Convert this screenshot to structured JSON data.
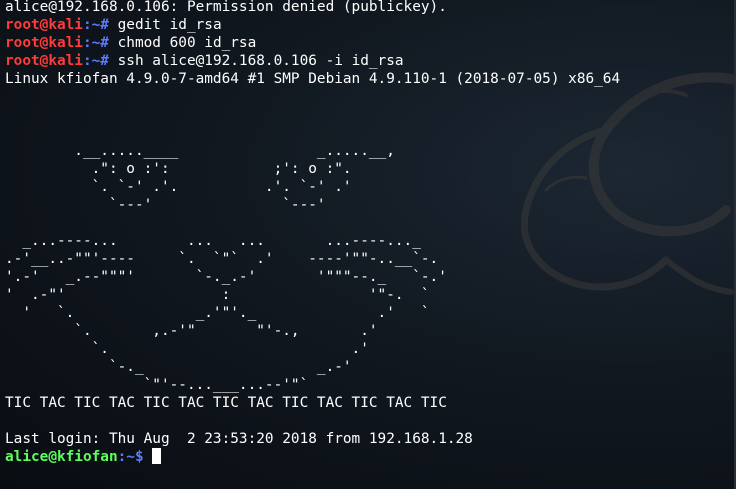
{
  "terminal": {
    "line_perm_denied": "alice@192.168.0.106: Permission denied (publickey).",
    "root_prompt_user": "root@kali",
    "root_prompt_path": ":~# ",
    "cmd1": "gedit id_rsa",
    "cmd2": "chmod 600 id_rsa",
    "cmd3": "ssh alice@192.168.0.106 -i id_rsa",
    "uname_line": "Linux kfiofan 4.9.0-7-amd64 #1 SMP Debian 4.9.110-1 (2018-07-05) x86_64",
    "banner_art": "\n\n\n        .__.....____                _.....__,\n          .\": o :':            ;': o :\".\n          `. `-' .'.          .'. `-' .'\n            `---'               `---'\n\n  _...----...        ...   ...       ...----..._\n.-'__..-\"\"'----     `.  `\"`  .'    ----'\"\"-..__`-.\n'.-'   _.--\"\"\"'       `-._.-'       '\"\"\"--._   `-.'\n'  .-\"'                  :                '\"-.  `\n  '   `.              _.'\"'._              .'   `\n        `.       ,.-'\"       \"'-.,       .'\n          `.                            .'\n            `-._                    _.-'\n                `\"'--...___...--'\"`\n",
    "tic_tac_line": "TIC TAC TIC TAC TIC TAC TIC TAC TIC TAC TIC TAC TIC",
    "last_login": "Last login: Thu Aug  2 23:53:20 2018 from 192.168.1.28",
    "user_prompt_user": "alice@kfiofan",
    "user_prompt_path": ":~$ "
  },
  "colors": {
    "root_prompt": "#ff3b3b",
    "path": "#5c7cff",
    "user_prompt": "#5cff5c",
    "text": "#ffffff",
    "background": "#0b0f14"
  },
  "icons": {
    "background_logo": "kali-dragon-icon"
  }
}
